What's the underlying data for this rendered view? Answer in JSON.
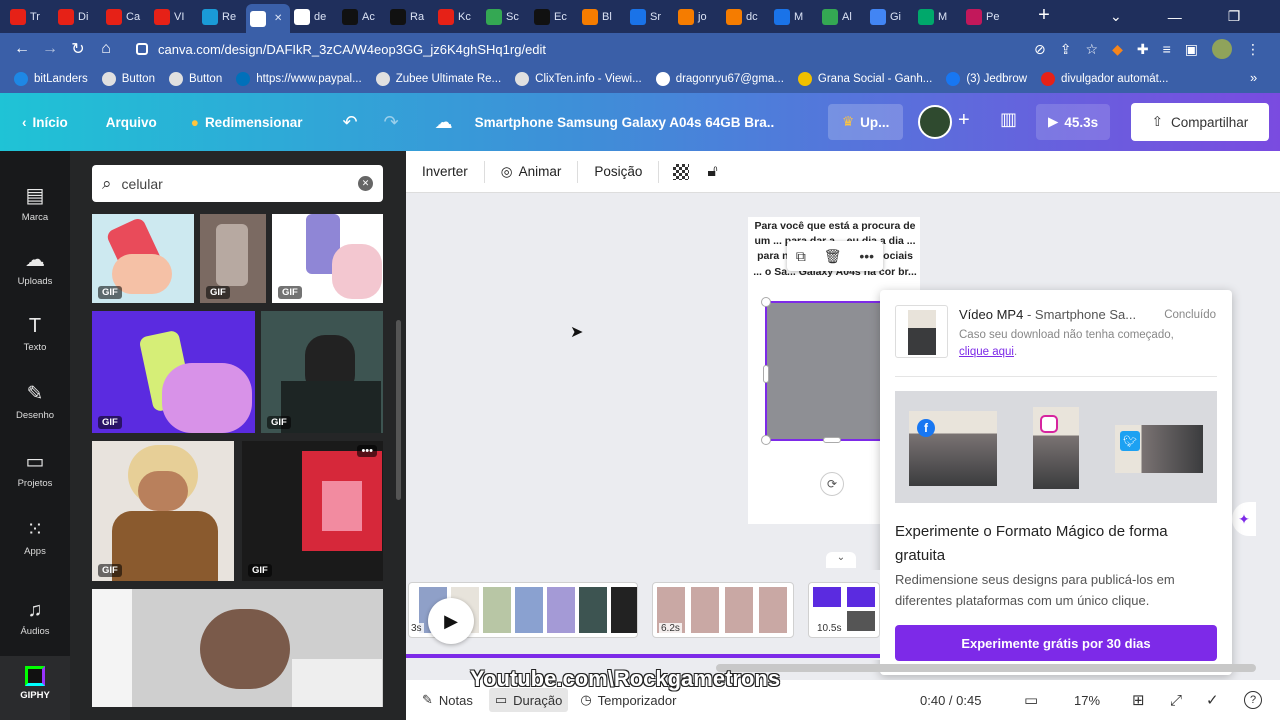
{
  "tabs": [
    {
      "label": "Tr",
      "color": "#e62117"
    },
    {
      "label": "Di",
      "color": "#e62117"
    },
    {
      "label": "Ca",
      "color": "#e62117"
    },
    {
      "label": "VI",
      "color": "#e62117"
    },
    {
      "label": "Re",
      "color": "#1a9bd7"
    },
    {
      "label": "",
      "color": "#ffffff",
      "active": true
    },
    {
      "label": "de",
      "color": "#ffffff"
    },
    {
      "label": "Ac",
      "color": "#111111"
    },
    {
      "label": "Ra",
      "color": "#111111"
    },
    {
      "label": "Kc",
      "color": "#e62117"
    },
    {
      "label": "Sc",
      "color": "#34a853"
    },
    {
      "label": "Ec",
      "color": "#111111"
    },
    {
      "label": "Bl",
      "color": "#f57c00"
    },
    {
      "label": "Sr",
      "color": "#1a73e8"
    },
    {
      "label": "jo",
      "color": "#f57c00"
    },
    {
      "label": "dc",
      "color": "#f57c00"
    },
    {
      "label": "M",
      "color": "#1a73e8"
    },
    {
      "label": "Al",
      "color": "#34a853"
    },
    {
      "label": "Gi",
      "color": "#4285f4"
    },
    {
      "label": "M",
      "color": "#00a86b"
    },
    {
      "label": "Pe",
      "color": "#c2185b"
    }
  ],
  "browser": {
    "url": "canva.com/design/DAFIkR_3zCA/W4eop3GG_jz6K4ghSHq1rg/edit",
    "bookmarks": [
      "bitLanders",
      "Button",
      "Button",
      "https://www.paypal...",
      "Zubee Ultimate Re...",
      "ClixTen.info - Viewi...",
      "dragonryu67@gma...",
      "Grana Social - Ganh...",
      "(3) Jedbrow",
      "divulgador automát..."
    ]
  },
  "header": {
    "back": "Início",
    "file": "Arquivo",
    "resize": "Redimensionar",
    "title": "Smartphone Samsung Galaxy A04s 64GB Bra...",
    "upgrade": "Up...",
    "duration": "45.3s",
    "share": "Compartilhar"
  },
  "sidebar": [
    "Marca",
    "Uploads",
    "Texto",
    "Desenho",
    "Projetos",
    "Apps",
    "Áudios",
    "GIPHY"
  ],
  "search": {
    "value": "celular"
  },
  "gif_label": "GIF",
  "toolbar": {
    "flip": "Inverter",
    "animate": "Animar",
    "position": "Posição"
  },
  "canvas_text": "Para você que está a procura de um ... para dar a... eu dia a dia ... para navegar nas redes sociais ... o Sa... Galaxy A04s na cor br...",
  "popup": {
    "title": "Vídeo MP4",
    "subtitle": "- Smartphone Sa...",
    "status": "Concluído",
    "hint": "Caso seu download não tenha começado,",
    "link": "clique aqui",
    "promo_title": "Experimente o Formato Mágico de forma gratuita",
    "promo_desc": "Redimensione seus designs para publicá-los em diferentes plataformas com um único clique.",
    "cta": "Experimente grátis por 30 dias"
  },
  "timeline": {
    "clip1_time": "3s",
    "clip2_time": "6.2s",
    "clip3_time": "10.5s"
  },
  "bottom": {
    "notes": "Notas",
    "duration": "Duração",
    "timer": "Temporizador",
    "time": "0:40 / 0:45",
    "zoom": "17%"
  },
  "watermark": "Youtube.com\\Rockgametrons"
}
